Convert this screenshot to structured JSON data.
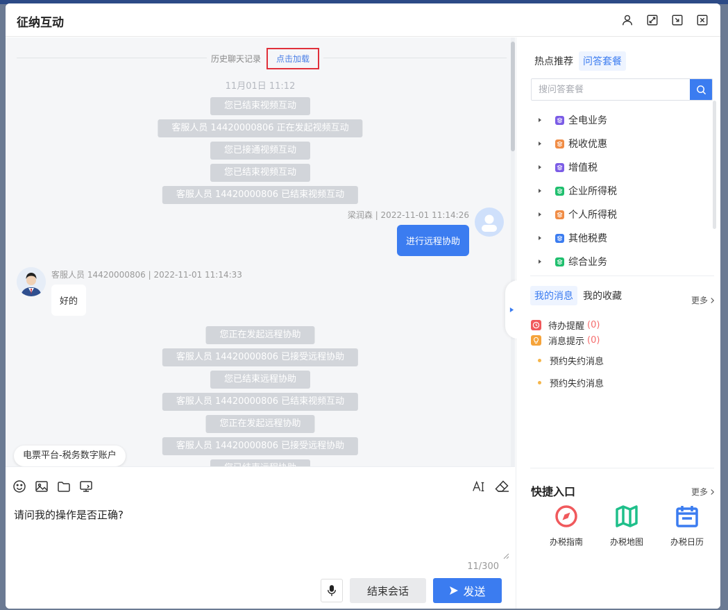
{
  "window": {
    "title": "征纳互动"
  },
  "chat": {
    "history_label": "历史聊天记录",
    "load_label": "点击加载",
    "time_separator": "11月01日 11:12",
    "system_messages_1": [
      "您已结束视频互动",
      "客服人员 14420000806 正在发起视频互动",
      "您已接通视频互动",
      "您已结束视频互动",
      "客服人员 14420000806 已结束视频互动"
    ],
    "user_meta": "梁润森 | 2022-11-01 11:14:26",
    "user_message": "进行远程协助",
    "agent_meta": "客服人员 14420000806 | 2022-11-01 11:14:33",
    "agent_message": "好的",
    "system_messages_2": [
      "您正在发起远程协助",
      "客服人员 14420000806 已接受远程协助",
      "您已结束远程协助",
      "客服人员 14420000806 已结束视频互动",
      "您正在发起远程协助",
      "客服人员 14420000806 已接受远程协助",
      "您已结束远程协助"
    ],
    "float_tag": "电票平台-税务数字账户"
  },
  "input": {
    "text": "请问我的操作是否正确?",
    "counter": "11/300",
    "end_label": "结束会话",
    "send_label": "发送"
  },
  "right": {
    "tabs": [
      "热点推荐",
      "问答套餐"
    ],
    "search_placeholder": "搜问答套餐",
    "tree": [
      {
        "label": "全电业务",
        "color": "#7b5ce6"
      },
      {
        "label": "税收优惠",
        "color": "#f08c45"
      },
      {
        "label": "增值税",
        "color": "#7b5ce6"
      },
      {
        "label": "企业所得税",
        "color": "#1fbf6e"
      },
      {
        "label": "个人所得税",
        "color": "#f08c45"
      },
      {
        "label": "其他税费",
        "color": "#3b7cf0"
      },
      {
        "label": "综合业务",
        "color": "#1fbf6e"
      }
    ],
    "msg_tabs": [
      "我的消息",
      "我的收藏"
    ],
    "more_label": "更多",
    "messages": [
      {
        "label": "待办提醒",
        "count": "(0)",
        "color": "#f0595c"
      },
      {
        "label": "消息提示",
        "count": "(0)",
        "color": "#f5a33a"
      }
    ],
    "sub_messages": [
      "预约失约消息",
      "预约失约消息"
    ],
    "quick_title": "快捷入口",
    "quick_more": "更多",
    "quick": [
      {
        "label": "办税指南",
        "color": "#f0595c",
        "icon": "compass-icon"
      },
      {
        "label": "办税地图",
        "color": "#1fbf8a",
        "icon": "map-icon"
      },
      {
        "label": "办税日历",
        "color": "#3b7cf0",
        "icon": "calendar-icon"
      }
    ]
  }
}
